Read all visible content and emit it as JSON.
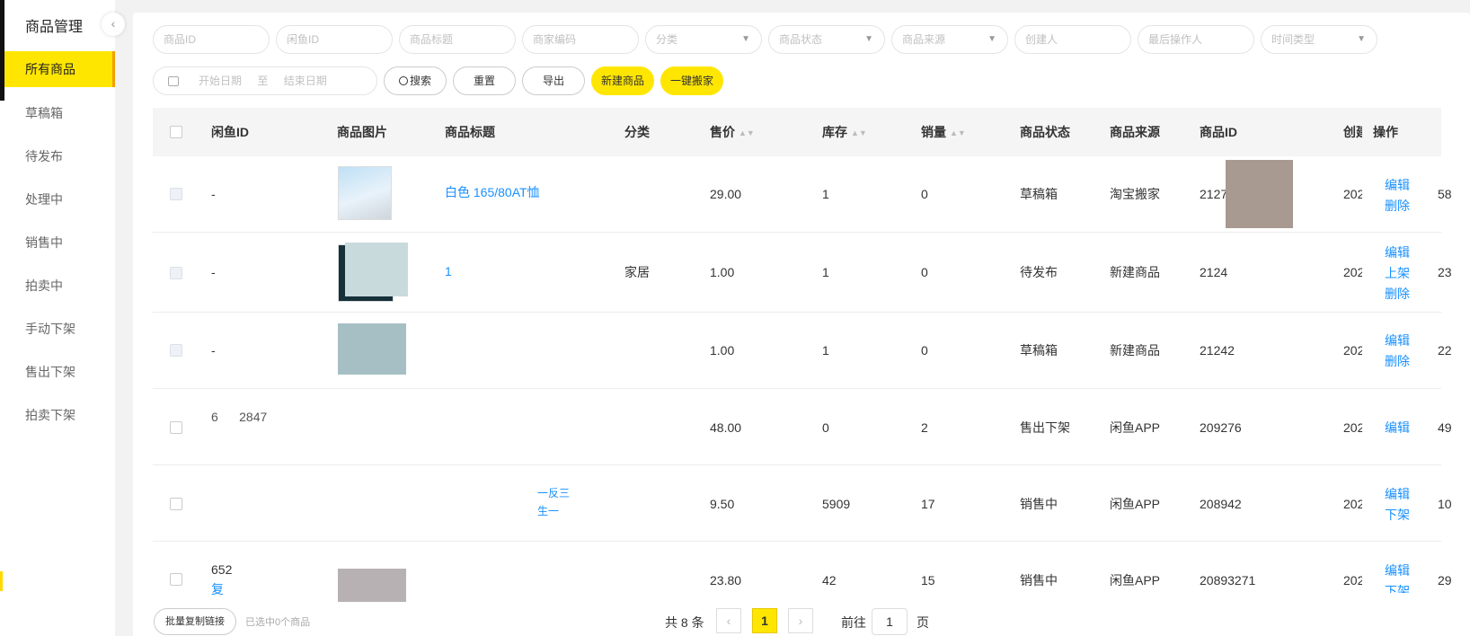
{
  "sidebar": {
    "title": "商品管理",
    "collapse_icon": "chevron-left-icon",
    "items": [
      {
        "label": "所有商品"
      },
      {
        "label": "草稿箱"
      },
      {
        "label": "待发布"
      },
      {
        "label": "处理中"
      },
      {
        "label": "销售中"
      },
      {
        "label": "拍卖中"
      },
      {
        "label": "手动下架"
      },
      {
        "label": "售出下架"
      },
      {
        "label": "拍卖下架"
      }
    ],
    "active_index": 0
  },
  "filters": {
    "product_id_placeholder": "商品ID",
    "xianyu_id_placeholder": "闲鱼ID",
    "title_placeholder": "商品标题",
    "merchant_code_placeholder": "商家编码",
    "category_placeholder": "分类",
    "status_placeholder": "商品状态",
    "source_placeholder": "商品来源",
    "creator_placeholder": "创建人",
    "last_operator_placeholder": "最后操作人",
    "time_type_placeholder": "时间类型",
    "start_date_placeholder": "开始日期",
    "range_separator": "至",
    "end_date_placeholder": "结束日期"
  },
  "toolbar": {
    "search_label": "搜索",
    "reset_label": "重置",
    "export_label": "导出",
    "new_product_label": "新建商品",
    "one_click_move_label": "一键搬家"
  },
  "table": {
    "headers": {
      "xianyu_id": "闲鱼ID",
      "image": "商品图片",
      "title": "商品标题",
      "category": "分类",
      "price": "售价",
      "stock": "库存",
      "sales": "销量",
      "status": "商品状态",
      "source": "商品来源",
      "product_id": "商品ID",
      "created": "创建",
      "actions": "操作"
    },
    "rows": [
      {
        "xianyu_id": "-",
        "title": "白色 165/80AT恤",
        "category": "",
        "price": "29.00",
        "stock": "1",
        "sales": "0",
        "status": "草稿箱",
        "source": "淘宝搬家",
        "product_id": "2127",
        "created": "202",
        "tail": "58",
        "actions": [
          "编辑",
          "删除"
        ]
      },
      {
        "xianyu_id": "-",
        "title": "1",
        "category": "家居",
        "price": "1.00",
        "stock": "1",
        "sales": "0",
        "status": "待发布",
        "source": "新建商品",
        "product_id": "2124",
        "created": "202",
        "tail": "23",
        "actions": [
          "编辑",
          "上架",
          "删除"
        ]
      },
      {
        "xianyu_id": "-",
        "title": "",
        "category": "",
        "price": "1.00",
        "stock": "1",
        "sales": "0",
        "status": "草稿箱",
        "source": "新建商品",
        "product_id": "21242",
        "created": "202",
        "tail": "22",
        "actions": [
          "编辑",
          "删除"
        ]
      },
      {
        "xianyu_id": "6      2847",
        "title": "",
        "category": "",
        "price": "48.00",
        "stock": "0",
        "sales": "2",
        "status": "售出下架",
        "source": "闲鱼APP",
        "product_id": "209276",
        "created": "202",
        "tail": "49",
        "actions": [
          "编辑"
        ]
      },
      {
        "xianyu_id": "",
        "title": "一反三",
        "title2": "生一",
        "category": "",
        "price": "9.50",
        "stock": "5909",
        "sales": "17",
        "status": "销售中",
        "source": "闲鱼APP",
        "product_id": "208942",
        "created": "202",
        "tail": "10",
        "actions": [
          "编辑",
          "下架"
        ]
      },
      {
        "xianyu_id": "652",
        "xianyu_id_link": "复",
        "title": "",
        "category": "",
        "price": "23.80",
        "stock": "42",
        "sales": "15",
        "status": "销售中",
        "source": "闲鱼APP",
        "product_id": "20893271",
        "created": "202",
        "tail": "29",
        "actions": [
          "编辑",
          "下架"
        ]
      }
    ]
  },
  "footer": {
    "batch_copy_label": "批量复制链接",
    "selected_text": "已选中0个商品",
    "total_text": "共 8 条",
    "current_page": "1",
    "goto_label": "前往",
    "goto_value": "1",
    "page_unit": "页"
  },
  "colors": {
    "accent": "#ffe600",
    "link": "#1890ff"
  }
}
